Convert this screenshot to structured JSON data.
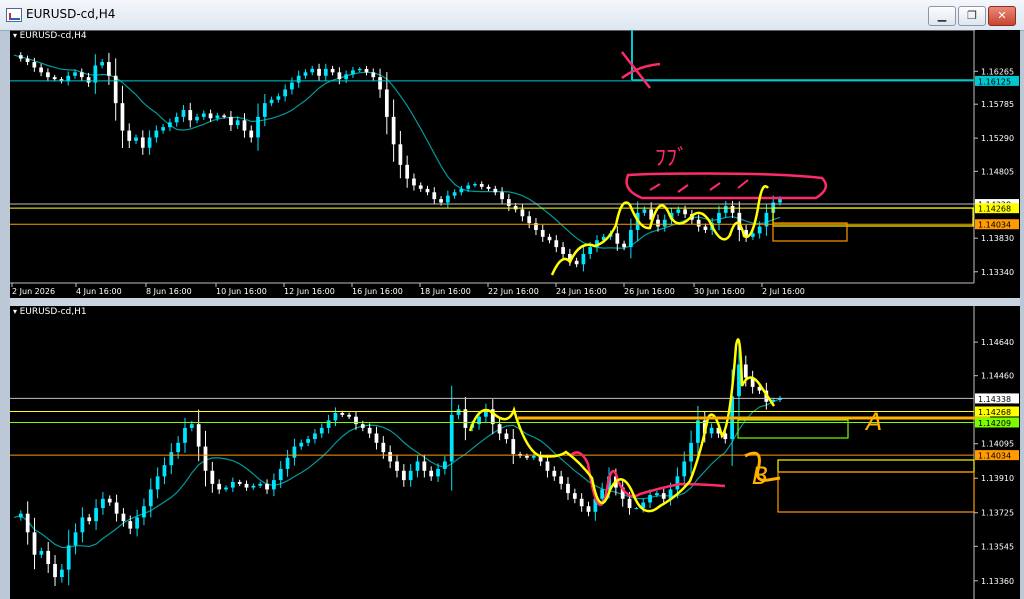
{
  "window": {
    "title": "EURUSD-cd,H4",
    "buttons": [
      "minimize",
      "restore",
      "close"
    ]
  },
  "colors": {
    "bull": "#00e5ff",
    "bear": "#ffffff",
    "ma": "#009a9a",
    "cyan_level": "#00c8d0",
    "orange_level": "#ff9a00",
    "yellow_level": "#ffff00",
    "green_level": "#7cfc00",
    "pen_pink": "#ff2a6a",
    "pen_yellow": "#ffff00",
    "pen_orange": "#ffb000",
    "grid": "#808080"
  },
  "chart_h4": {
    "label": "EURUSD-cd,H4",
    "price_ticks": [
      "1.16265",
      "1.15785",
      "1.15290",
      "1.14805",
      "1.14328",
      "1.13830",
      "1.13340"
    ],
    "time_ticks": [
      "2 Jun 2026",
      "4 Jun 16:00",
      "8 Jun 16:00",
      "10 Jun 16:00",
      "12 Jun 16:00",
      "16 Jun 16:00",
      "18 Jun 16:00",
      "22 Jun 16:00",
      "24 Jun 16:00",
      "26 Jun 16:00",
      "30 Jun 16:00",
      "2 Jul 16:00"
    ],
    "badges": {
      "cyan": "1.16125",
      "white": "1.14328",
      "yellow": "1.14268",
      "orange": "1.14034"
    },
    "annotation_text": "ﾌﾌﾞ",
    "price_range": [
      1.1322,
      1.1678
    ],
    "levels": [
      1.16125,
      1.14328,
      1.14268,
      1.14034
    ],
    "series": [
      1.165,
      1.1645,
      1.164,
      1.1632,
      1.1625,
      1.1618,
      1.1615,
      1.1612,
      1.162,
      1.1625,
      1.1618,
      1.161,
      1.1635,
      1.164,
      1.162,
      1.158,
      1.154,
      1.1525,
      1.153,
      1.1515,
      1.153,
      1.154,
      1.1545,
      1.1552,
      1.156,
      1.157,
      1.1555,
      1.156,
      1.1565,
      1.1558,
      1.1562,
      1.156,
      1.1548,
      1.1555,
      1.154,
      1.153,
      1.156,
      1.158,
      1.1585,
      1.159,
      1.16,
      1.161,
      1.162,
      1.1625,
      1.163,
      1.162,
      1.163,
      1.1625,
      1.1615,
      1.1622,
      1.1628,
      1.163,
      1.1625,
      1.1618,
      1.16,
      1.156,
      1.152,
      1.149,
      1.147,
      1.146,
      1.1455,
      1.145,
      1.144,
      1.1435,
      1.1445,
      1.145,
      1.1455,
      1.146,
      1.1462,
      1.1458,
      1.1455,
      1.145,
      1.144,
      1.143,
      1.1425,
      1.1415,
      1.1405,
      1.1395,
      1.1385,
      1.138,
      1.137,
      1.136,
      1.135,
      1.1345,
      1.136,
      1.137,
      1.138,
      1.1385,
      1.139,
      1.1375,
      1.137,
      1.1395,
      1.142,
      1.1425,
      1.141,
      1.14,
      1.141,
      1.142,
      1.1425,
      1.1418,
      1.141,
      1.14,
      1.1395,
      1.1405,
      1.142,
      1.143,
      1.142,
      1.1395,
      1.1385,
      1.139,
      1.14,
      1.142,
      1.1435,
      1.144
    ]
  },
  "chart_h1": {
    "label": "EURUSD-cd,H1",
    "price_ticks": [
      "1.14640",
      "1.14460",
      "1.14095",
      "1.13910",
      "1.13725",
      "1.13545",
      "1.13360"
    ],
    "badges": {
      "white": "1.14338",
      "yellow": "1.14268",
      "green": "1.14209",
      "orange": "1.14034"
    },
    "annotation_a": "A",
    "annotation_b": "B",
    "price_range": [
      1.133,
      1.1478
    ],
    "levels": [
      1.14338,
      1.14268,
      1.14209,
      1.14034
    ],
    "series": [
      1.137,
      1.1372,
      1.1362,
      1.135,
      1.1352,
      1.1345,
      1.1338,
      1.1342,
      1.1355,
      1.1362,
      1.137,
      1.1368,
      1.1375,
      1.138,
      1.1378,
      1.1372,
      1.1368,
      1.1364,
      1.137,
      1.1376,
      1.1385,
      1.1392,
      1.1398,
      1.1405,
      1.141,
      1.1418,
      1.142,
      1.1408,
      1.1395,
      1.1388,
      1.1385,
      1.1386,
      1.1389,
      1.1388,
      1.1386,
      1.1387,
      1.1388,
      1.1385,
      1.139,
      1.1396,
      1.1402,
      1.1408,
      1.141,
      1.1412,
      1.1415,
      1.1418,
      1.1422,
      1.1426,
      1.1425,
      1.1424,
      1.142,
      1.1418,
      1.1415,
      1.141,
      1.1405,
      1.14,
      1.1395,
      1.139,
      1.1395,
      1.14,
      1.1395,
      1.1392,
      1.1396,
      1.14,
      1.1425,
      1.1428,
      1.1418,
      1.142,
      1.1424,
      1.1428,
      1.142,
      1.1415,
      1.1412,
      1.1404,
      1.1403,
      1.1402,
      1.1403,
      1.14,
      1.1395,
      1.1392,
      1.1388,
      1.1383,
      1.138,
      1.1376,
      1.1373,
      1.138,
      1.1385,
      1.1392,
      1.1386,
      1.138,
      1.1375,
      1.1375,
      1.1378,
      1.1382,
      1.1383,
      1.138,
      1.1385,
      1.1392,
      1.14,
      1.141,
      1.1422,
      1.1415,
      1.1418,
      1.1415,
      1.1412,
      1.1435,
      1.1452,
      1.1445,
      1.144,
      1.1438,
      1.1432,
      1.1433,
      1.1434
    ]
  }
}
